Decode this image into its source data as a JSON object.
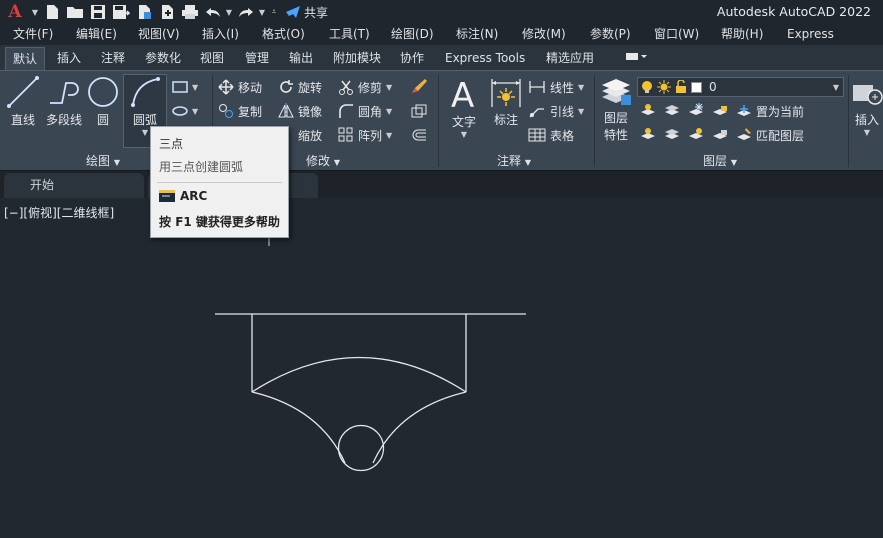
{
  "app": {
    "title": "Autodesk AutoCAD 2022",
    "logo": "A",
    "share_label": "共享"
  },
  "menus": [
    "文件(F)",
    "编辑(E)",
    "视图(V)",
    "插入(I)",
    "格式(O)",
    "工具(T)",
    "绘图(D)",
    "标注(N)",
    "修改(M)",
    "参数(P)",
    "窗口(W)",
    "帮助(H)",
    "Express"
  ],
  "ribbon_tabs": [
    "默认",
    "插入",
    "注释",
    "参数化",
    "视图",
    "管理",
    "输出",
    "附加模块",
    "协作",
    "Express Tools",
    "精选应用"
  ],
  "active_tab": "默认",
  "draw_panel": {
    "title": "绘图",
    "line": "直线",
    "polyline": "多段线",
    "circle": "圆",
    "arc": "圆弧"
  },
  "modify_panel": {
    "title": "修改",
    "move": "移动",
    "rotate": "旋转",
    "trim": "修剪",
    "copy": "复制",
    "mirror": "镜像",
    "fillet": "圆角",
    "scale": "缩放",
    "array": "阵列"
  },
  "annotation_panel": {
    "title": "注释",
    "text": "文字",
    "dimension": "标注",
    "linear": "线性",
    "leader": "引线",
    "table": "表格"
  },
  "layers_panel": {
    "title": "图层",
    "properties_line1": "图层",
    "properties_line2": "特性",
    "current_layer": "0",
    "set_current": "置为当前",
    "match_layer": "匹配图层"
  },
  "insert_panel": {
    "insert": "插入"
  },
  "file_tab": {
    "label": "开始"
  },
  "viewport_label": "[−][俯视][二维线框]",
  "tooltip": {
    "title": "三点",
    "description": "用三点创建圆弧",
    "command": "ARC",
    "help_prefix": "按 ",
    "help_key": "F1",
    "help_suffix": " 键获得更多帮助"
  },
  "colors": {
    "background": "#212830",
    "ribbon": "#3b4653",
    "menubar": "#1f262d",
    "tooltip_bg": "#f0f0f0",
    "logo_red": "#e23b3b",
    "bulb_yellow": "#f2c230"
  }
}
